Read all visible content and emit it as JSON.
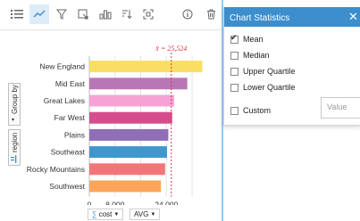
{
  "toolbar": {
    "icons": [
      "legend-icon",
      "trend-icon",
      "filter-icon",
      "flip-card-icon",
      "visualization-type-icon",
      "sort-icon",
      "maximize-icon",
      "info-icon",
      "delete-icon"
    ]
  },
  "axis_tabs": {
    "group_by": "Group by",
    "region": "region"
  },
  "chart_data": {
    "type": "bar",
    "orientation": "horizontal",
    "categories": [
      "New England",
      "Mid East",
      "Great Lakes",
      "Far West",
      "Plains",
      "Southeast",
      "Rocky Mountains",
      "Southwest"
    ],
    "values": [
      35200,
      30500,
      26400,
      25800,
      24600,
      24200,
      23600,
      22300
    ],
    "colors": [
      "#f9de66",
      "#b876b7",
      "#f4a3d4",
      "#d54d8d",
      "#8e6fb8",
      "#3f97ce",
      "#f27679",
      "#fba55a"
    ],
    "xlim": [
      0,
      37000
    ],
    "x_ticks": [
      0,
      8000,
      24000
    ],
    "x_tick_labels": [
      "0",
      "8,000",
      "24,000"
    ],
    "mean_value": 25524,
    "mean_label": "x̄ = 25,524",
    "grid": true
  },
  "bottom": {
    "field_label": "cost",
    "stat_label": "AVG"
  },
  "panel": {
    "title": "Chart Statistics",
    "options": [
      {
        "label": "Mean",
        "checked": true
      },
      {
        "label": "Median",
        "checked": false
      },
      {
        "label": "Upper Quartile",
        "checked": false
      },
      {
        "label": "Lower Quartile",
        "checked": false
      },
      {
        "label": "Custom",
        "checked": false
      }
    ],
    "custom_placeholder": "Value"
  }
}
